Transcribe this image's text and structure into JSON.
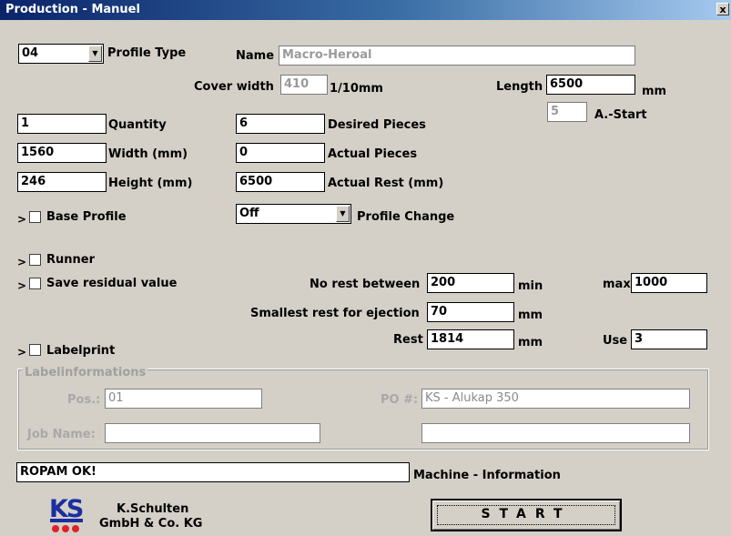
{
  "window": {
    "title": "Production - Manuel",
    "close_glyph": "x"
  },
  "profile": {
    "type_value": "04",
    "type_label": "Profile Type",
    "name_label": "Name",
    "name_value": "Macro-Heroal",
    "cover_width_label": "Cover width",
    "cover_width_value": "410",
    "cover_width_unit": "1/10mm",
    "length_label": "Length",
    "length_value": "6500",
    "length_unit": "mm",
    "astart_value": "5",
    "astart_label": "A.-Start"
  },
  "fields": {
    "quantity_value": "1",
    "quantity_label": "Quantity",
    "width_value": "1560",
    "width_label": "Width (mm)",
    "height_value": "246",
    "height_label": "Height (mm)",
    "desired_value": "6",
    "desired_label": "Desired Pieces",
    "actual_value": "0",
    "actual_label": "Actual Pieces",
    "rest_value": "6500",
    "rest_label": "Actual Rest (mm)"
  },
  "options": {
    "expander": ">",
    "base_profile_label": "Base Profile",
    "profile_change_value": "Off",
    "profile_change_label": "Profile Change",
    "runner_label": "Runner",
    "save_residual_label": "Save residual value",
    "labelprint_label": "Labelprint"
  },
  "residual": {
    "no_rest_label": "No rest between",
    "no_rest_min": "200",
    "min_label": "min",
    "max_label": "max",
    "max_value": "1000",
    "smallest_label": "Smallest rest for ejection",
    "smallest_value": "70",
    "smallest_unit": "mm",
    "rest_label": "Rest",
    "rest_value": "1814",
    "rest_unit": "mm",
    "use_label": "Use",
    "use_value": "3"
  },
  "labelinfo": {
    "legend": "Labelinformations",
    "pos_label": "Pos.:",
    "pos_value": "01",
    "po_label": "PO #:",
    "po_value": "KS - Alukap 350",
    "job_label": "Job Name:",
    "job_value": "",
    "extra_value": ""
  },
  "machine": {
    "status_value": "ROPAM OK!",
    "info_label": "Machine - Information"
  },
  "footer": {
    "company_line1": "K.Schulten",
    "company_line2": "GmbH & Co. KG",
    "logo_text": "KS",
    "start_label": "START"
  },
  "colors": {
    "logo_blue": "#1a2fa0",
    "logo_red": "#e0202a"
  }
}
